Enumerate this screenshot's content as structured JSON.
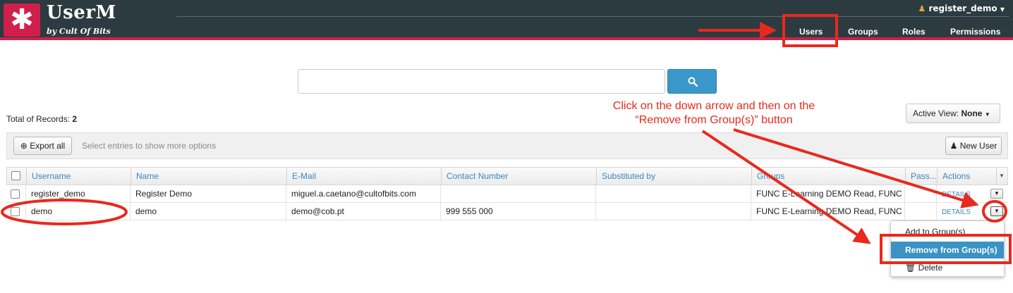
{
  "app": {
    "logo_glyph": "✱",
    "title": "UserM",
    "subtitle": "by Cult Of Bits",
    "current_user": "register_demo"
  },
  "nav": {
    "items": [
      {
        "label": "Users",
        "active": true
      },
      {
        "label": "Groups"
      },
      {
        "label": "Roles"
      },
      {
        "label": "Permissions"
      }
    ]
  },
  "search": {
    "placeholder": "",
    "icon": "search-icon"
  },
  "records": {
    "label": "Total of Records:",
    "count": "2"
  },
  "active_view": {
    "label": "Active View:",
    "value": "None"
  },
  "toolbar": {
    "export_label": "Export all",
    "hint": "Select entries to show more options",
    "new_user_label": "New User"
  },
  "table": {
    "columns": [
      "Username",
      "Name",
      "E-Mail",
      "Contact Number",
      "Substituted by",
      "Groups",
      "Pass...",
      "Actions"
    ],
    "rows": [
      {
        "username": "register_demo",
        "name": "Register Demo",
        "email": "miguel.a.caetano@cultofbits.com",
        "contact": "",
        "substituted_by": "",
        "groups": "FUNC E-Learning DEMO Read, FUNC ...",
        "pass": "",
        "action": "DETAILS"
      },
      {
        "username": "demo",
        "name": "demo",
        "email": "demo@cob.pt",
        "contact": "999 555 000",
        "substituted_by": "",
        "groups": "FUNC E-Learning DEMO Read, FUNC ...",
        "pass": "",
        "action": "DETAILS"
      }
    ]
  },
  "row_menu": {
    "items": [
      "Add to Group(s)",
      "Remove from Group(s)",
      "Delete"
    ],
    "highlighted": "Remove from Group(s)"
  },
  "annotation": {
    "line1": "Click on the down arrow and then on the",
    "line2": "“Remove from Group(s)” button",
    "color": "#e8291d"
  },
  "colors": {
    "header_bg": "#2c3b40",
    "brand": "#d11f4c",
    "accent": "#3a93c4"
  }
}
